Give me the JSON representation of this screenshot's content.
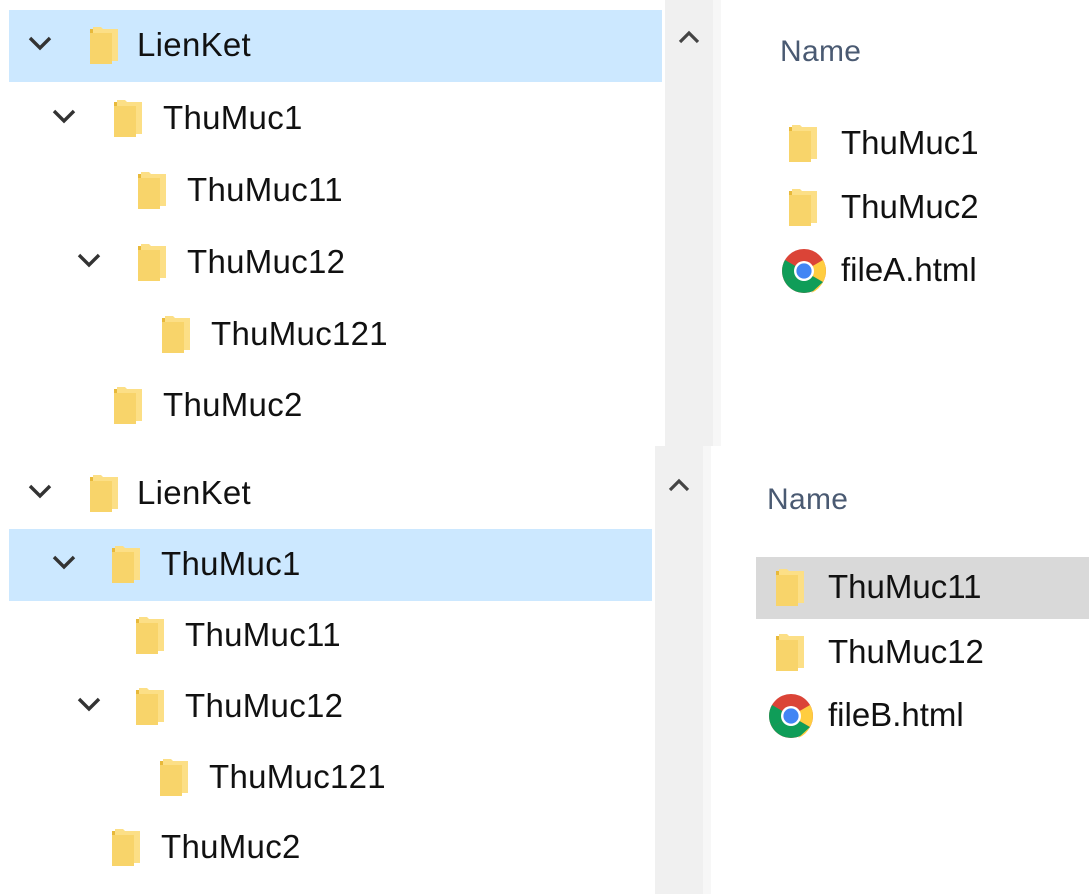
{
  "colors": {
    "selection": "#cce8ff",
    "hover": "#d9d9d9",
    "folder": "#f8d775",
    "header_text": "#4a5a72"
  },
  "top_panel": {
    "tree": [
      {
        "label": "LienKet",
        "expanded": true,
        "selected": true
      },
      {
        "label": "ThuMuc1",
        "expanded": true
      },
      {
        "label": "ThuMuc11"
      },
      {
        "label": "ThuMuc12",
        "expanded": true
      },
      {
        "label": "ThuMuc121"
      },
      {
        "label": "ThuMuc2"
      }
    ],
    "list": {
      "header": "Name",
      "items": [
        {
          "name": "ThuMuc1",
          "icon": "folder-icon"
        },
        {
          "name": "ThuMuc2",
          "icon": "folder-icon"
        },
        {
          "name": "fileA.html",
          "icon": "chrome-icon"
        }
      ]
    }
  },
  "bottom_panel": {
    "tree": [
      {
        "label": "LienKet",
        "expanded": true
      },
      {
        "label": "ThuMuc1",
        "expanded": true,
        "selected": true
      },
      {
        "label": "ThuMuc11"
      },
      {
        "label": "ThuMuc12",
        "expanded": true
      },
      {
        "label": "ThuMuc121"
      },
      {
        "label": "ThuMuc2"
      }
    ],
    "list": {
      "header": "Name",
      "items": [
        {
          "name": "ThuMuc11",
          "icon": "folder-icon",
          "hovered": true
        },
        {
          "name": "ThuMuc12",
          "icon": "folder-icon"
        },
        {
          "name": "fileB.html",
          "icon": "chrome-icon"
        }
      ]
    }
  }
}
